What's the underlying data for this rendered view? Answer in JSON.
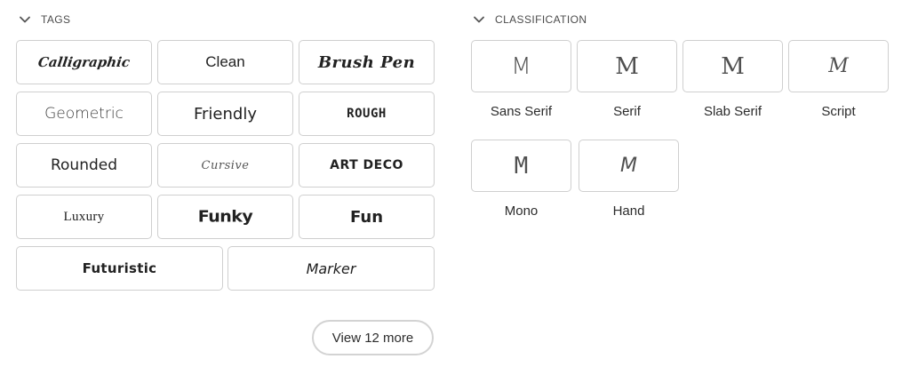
{
  "tags_section": {
    "title": "TAGS",
    "tags": [
      {
        "label": "Calligraphic"
      },
      {
        "label": "Clean"
      },
      {
        "label": "Brush Pen"
      },
      {
        "label": "Geometric"
      },
      {
        "label": "Friendly"
      },
      {
        "label": "ROUGH"
      },
      {
        "label": "Rounded"
      },
      {
        "label": "Cursive"
      },
      {
        "label": "ART DECO"
      },
      {
        "label": "Luxury"
      },
      {
        "label": "Funky"
      },
      {
        "label": "Fun"
      },
      {
        "label": "Futuristic"
      },
      {
        "label": "Marker"
      }
    ],
    "more_button": "View 12 more"
  },
  "classification_section": {
    "title": "CLASSIFICATION",
    "items": [
      {
        "glyph": "M",
        "label": "Sans Serif"
      },
      {
        "glyph": "M",
        "label": "Serif"
      },
      {
        "glyph": "M",
        "label": "Slab Serif"
      },
      {
        "glyph": "M",
        "label": "Script"
      },
      {
        "glyph": "M",
        "label": "Mono"
      },
      {
        "glyph": "M",
        "label": "Hand"
      }
    ]
  },
  "colors": {
    "border": "#cfcfcf",
    "text": "#2c2c2c",
    "glyph": "#505050"
  }
}
